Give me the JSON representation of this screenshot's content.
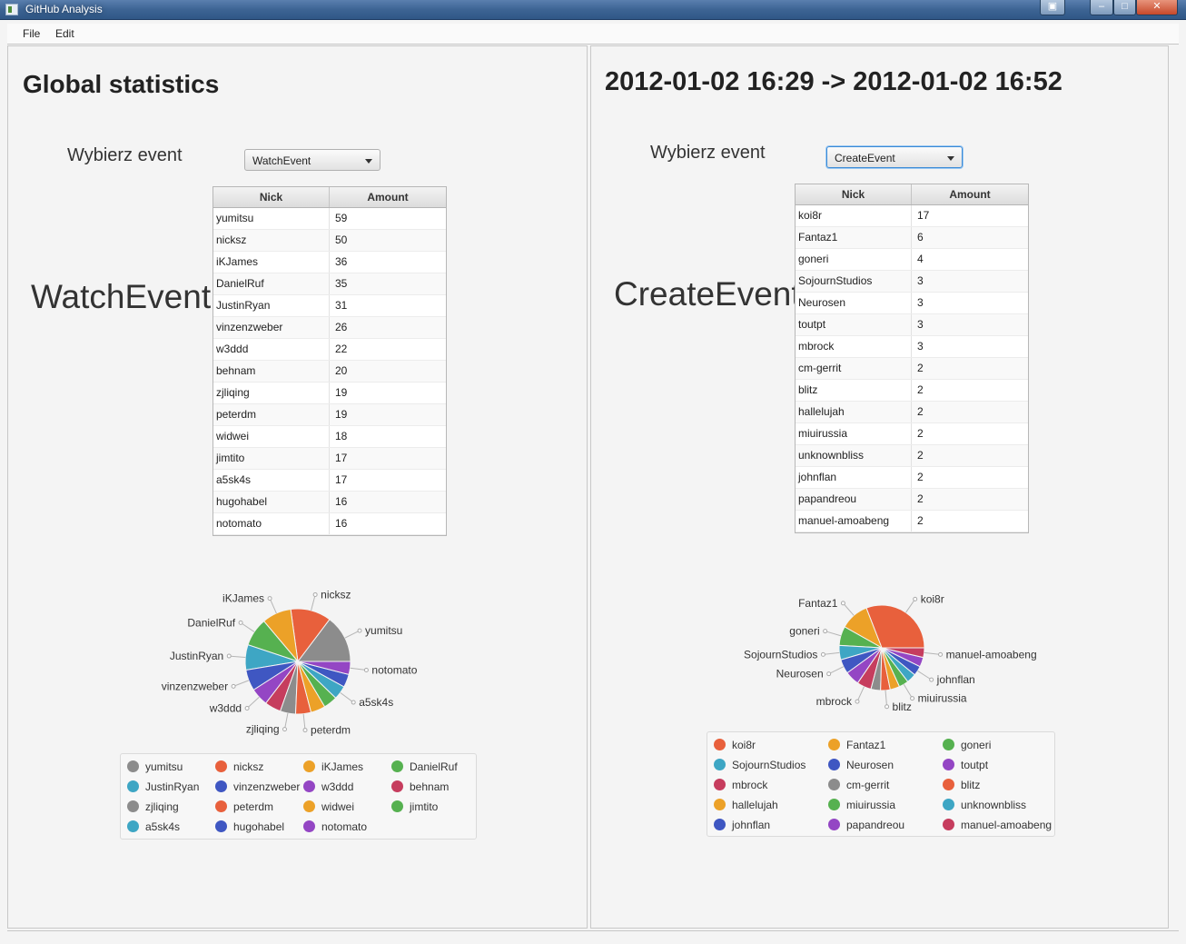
{
  "window": {
    "title": "GitHub Analysis"
  },
  "menu": {
    "file": "File",
    "edit": "Edit"
  },
  "left": {
    "heading": "Global statistics",
    "choose_label": "Wybierz event",
    "combo_value": "WatchEvent",
    "event_title": "WatchEvent",
    "table": {
      "headers": [
        "Nick",
        "Amount"
      ],
      "rows": [
        [
          "yumitsu",
          "59"
        ],
        [
          "nicksz",
          "50"
        ],
        [
          "iKJames",
          "36"
        ],
        [
          "DanielRuf",
          "35"
        ],
        [
          "JustinRyan",
          "31"
        ],
        [
          "vinzenzweber",
          "26"
        ],
        [
          "w3ddd",
          "22"
        ],
        [
          "behnam",
          "20"
        ],
        [
          "zjliqing",
          "19"
        ],
        [
          "peterdm",
          "19"
        ],
        [
          "widwei",
          "18"
        ],
        [
          "jimtito",
          "17"
        ],
        [
          "a5sk4s",
          "17"
        ],
        [
          "hugohabel",
          "16"
        ],
        [
          "notomato",
          "16"
        ]
      ]
    },
    "chart_data": {
      "type": "pie",
      "labels": [
        "yumitsu",
        "nicksz",
        "iKJames",
        "DanielRuf",
        "JustinRyan",
        "vinzenzweber",
        "w3ddd",
        "behnam",
        "zjliqing",
        "peterdm",
        "widwei",
        "jimtito",
        "a5sk4s",
        "hugohabel",
        "notomato"
      ],
      "values": [
        59,
        50,
        36,
        35,
        31,
        26,
        22,
        20,
        19,
        19,
        18,
        17,
        17,
        16,
        16
      ],
      "colors": [
        "#8c8c8c",
        "#e8603c",
        "#eca128",
        "#56b150",
        "#3ea6c4",
        "#3f57c2",
        "#9446c4",
        "#c63d5e",
        "#8c8c8c",
        "#e8603c",
        "#eca128",
        "#56b150",
        "#3ea6c4",
        "#3f57c2",
        "#9446c4"
      ],
      "shown_labels": [
        "yumitsu",
        "nicksz",
        "iKJames",
        "DanielRuf",
        "JustinRyan",
        "vinzenzweber",
        "w3ddd",
        "zjliqing",
        "peterdm",
        "a5sk4s",
        "notomato"
      ],
      "legend": "bottom",
      "legend_columns": 4
    }
  },
  "right": {
    "heading": "2012-01-02 16:29 -> 2012-01-02 16:52",
    "choose_label": "Wybierz event",
    "combo_value": "CreateEvent",
    "event_title": "CreateEvent",
    "table": {
      "headers": [
        "Nick",
        "Amount"
      ],
      "rows": [
        [
          "koi8r",
          "17"
        ],
        [
          "Fantaz1",
          "6"
        ],
        [
          "goneri",
          "4"
        ],
        [
          "SojournStudios",
          "3"
        ],
        [
          "Neurosen",
          "3"
        ],
        [
          "toutpt",
          "3"
        ],
        [
          "mbrock",
          "3"
        ],
        [
          "cm-gerrit",
          "2"
        ],
        [
          "blitz",
          "2"
        ],
        [
          "hallelujah",
          "2"
        ],
        [
          "miuirussia",
          "2"
        ],
        [
          "unknownbliss",
          "2"
        ],
        [
          "johnflan",
          "2"
        ],
        [
          "papandreou",
          "2"
        ],
        [
          "manuel-amoabeng",
          "2"
        ]
      ]
    },
    "chart_data": {
      "type": "pie",
      "labels": [
        "koi8r",
        "Fantaz1",
        "goneri",
        "SojournStudios",
        "Neurosen",
        "toutpt",
        "mbrock",
        "cm-gerrit",
        "blitz",
        "hallelujah",
        "miuirussia",
        "unknownbliss",
        "johnflan",
        "papandreou",
        "manuel-amoabeng"
      ],
      "values": [
        17,
        6,
        4,
        3,
        3,
        3,
        3,
        2,
        2,
        2,
        2,
        2,
        2,
        2,
        2
      ],
      "colors": [
        "#e8603c",
        "#eca128",
        "#56b150",
        "#3ea6c4",
        "#3f57c2",
        "#9446c4",
        "#c63d5e",
        "#8c8c8c",
        "#e8603c",
        "#eca128",
        "#56b150",
        "#3ea6c4",
        "#3f57c2",
        "#9446c4",
        "#c63d5e"
      ],
      "shown_labels": [
        "koi8r",
        "Fantaz1",
        "goneri",
        "SojournStudios",
        "Neurosen",
        "mbrock",
        "blitz",
        "miuirussia",
        "johnflan",
        "manuel-amoabeng"
      ],
      "legend": "bottom",
      "legend_columns": 3
    }
  }
}
